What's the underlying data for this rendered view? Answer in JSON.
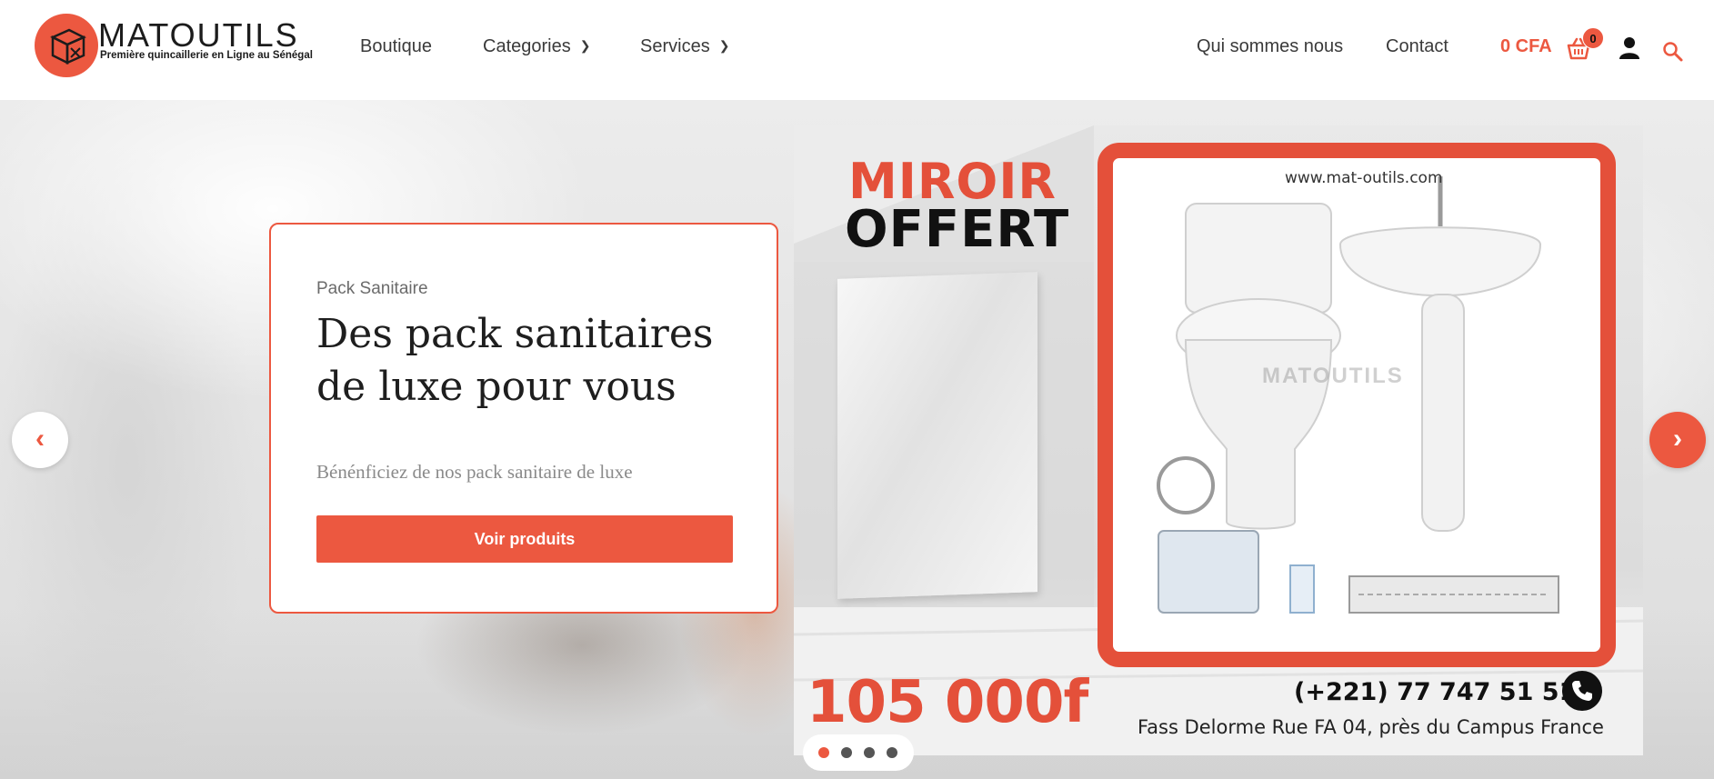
{
  "brand": {
    "name": "MATOUTILS",
    "tagline": "Première quincaillerie en Ligne au Sénégal",
    "accent_color": "#ec5840"
  },
  "nav": {
    "left": [
      {
        "label": "Boutique",
        "has_dropdown": false
      },
      {
        "label": "Categories",
        "has_dropdown": true
      },
      {
        "label": "Services",
        "has_dropdown": true
      }
    ],
    "right": [
      {
        "label": "Qui sommes nous"
      },
      {
        "label": "Contact"
      }
    ]
  },
  "cart": {
    "total": "0 CFA",
    "count": "0",
    "icon": "basket-icon"
  },
  "icons": {
    "user": "user-icon",
    "search": "search-icon",
    "chevron": "chevron-down-icon"
  },
  "slide": {
    "kicker": "Pack Sanitaire",
    "title": "Des pack sanitaires de luxe pour vous",
    "subtitle": "Bénénficiez de nos pack sanitaire de luxe",
    "button_label": "Voir produits"
  },
  "promo_image": {
    "headline_1": "MIROIR",
    "headline_2": "OFFERT",
    "website": "www.mat-outils.com",
    "price": "105 000f",
    "phone": "(+221) 77 747 51 51",
    "address": "Fass Delorme Rue FA 04, près du Campus France"
  },
  "slider": {
    "total_slides": 4,
    "active_index": 0,
    "prev_icon": "chevron-left-icon",
    "next_icon": "chevron-right-icon"
  }
}
